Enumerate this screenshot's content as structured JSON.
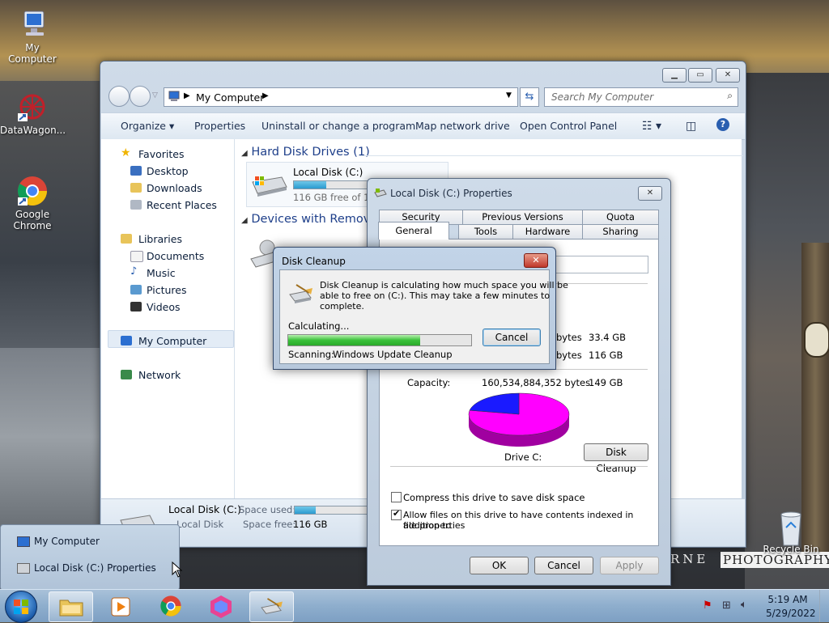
{
  "desktop": {
    "icons": [
      {
        "label": "My Computer"
      },
      {
        "label": "DataWagon..."
      },
      {
        "label": "Google Chrome"
      },
      {
        "label": "Recycle Bin"
      }
    ],
    "watermark_left": "RNE",
    "watermark_right": "PHOTOGRAPHY"
  },
  "explorer": {
    "address": "My Computer",
    "search_placeholder": "Search My Computer",
    "toolbar": [
      "Organize",
      "Properties",
      "Uninstall or change a program",
      "Map network drive",
      "Open Control Panel"
    ],
    "nav": {
      "favorites": "Favorites",
      "favorites_items": [
        "Desktop",
        "Downloads",
        "Recent Places"
      ],
      "libraries": "Libraries",
      "libraries_items": [
        "Documents",
        "Music",
        "Pictures",
        "Videos"
      ],
      "computer": "My Computer",
      "network": "Network"
    },
    "groups": {
      "hdd": "Hard Disk Drives (1)",
      "removable": "Devices with Removable Storage"
    },
    "drive": {
      "name": "Local Disk (C:)",
      "free_text": "116 GB free of 149 GB",
      "used_fraction": 0.22
    },
    "details": {
      "name": "Local Disk (C:)",
      "type": "Local Disk",
      "space_used_label": "Space used:",
      "space_free_label": "Space free:",
      "space_free_value": "116 GB",
      "used_fraction": 0.22
    }
  },
  "properties": {
    "title": "Local Disk (C:) Properties",
    "tabs_top": [
      "Security",
      "Previous Versions",
      "Quota"
    ],
    "tabs_bottom": [
      "General",
      "Tools",
      "Hardware",
      "Sharing"
    ],
    "used_bytes_suffix": "bytes",
    "used_gb": "33.4 GB",
    "free_bytes_suffix": "bytes",
    "free_gb": "116 GB",
    "capacity_label": "Capacity:",
    "capacity_bytes": "160,534,884,352 bytes",
    "capacity_gb": "149 GB",
    "drive_label": "Drive C:",
    "disk_cleanup_btn": "Disk Cleanup",
    "compress_label": "Compress this drive to save disk space",
    "compress_checked": false,
    "index_label_1": "Allow files on this drive to have contents indexed in addition to",
    "index_label_2": "file properties",
    "index_checked": true,
    "ok": "OK",
    "cancel": "Cancel",
    "apply": "Apply",
    "pie": {
      "used_fraction": 0.22,
      "used_color": "#1a1aff",
      "free_color": "#ff00ff"
    }
  },
  "disk_cleanup": {
    "title": "Disk Cleanup",
    "message_1": "Disk Cleanup is calculating how much space you will be",
    "message_2": "able to free on  (C:). This may take a few minutes to",
    "message_3": "complete.",
    "calculating": "Calculating...",
    "cancel": "Cancel",
    "scanning_label": "Scanning:",
    "scanning_item": "Windows Update Cleanup",
    "progress_fraction": 0.72
  },
  "popup": {
    "items": [
      "My Computer",
      "Local Disk (C:) Properties"
    ]
  },
  "taskbar": {
    "time": "5:19 AM",
    "date": "5/29/2022"
  }
}
